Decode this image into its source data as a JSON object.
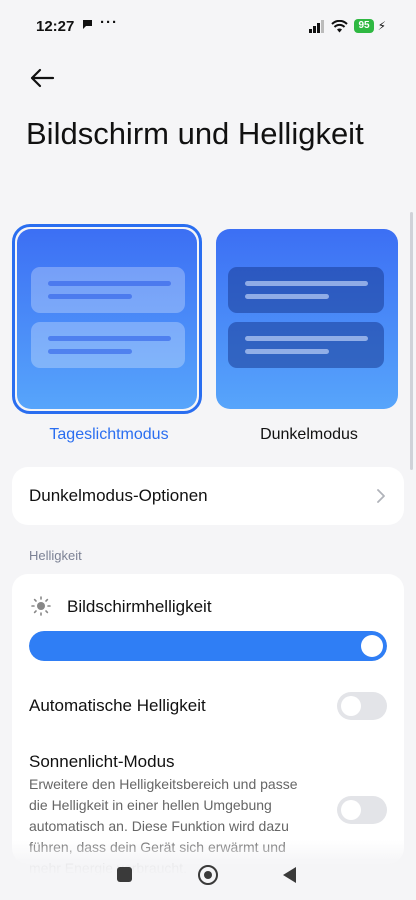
{
  "status_bar": {
    "time": "12:27",
    "notification_icon": "chat-bubble-icon",
    "more_indicator": "···",
    "battery_level": "95",
    "icons": [
      "signal-icon",
      "wifi-icon",
      "battery-icon",
      "charging-icon"
    ]
  },
  "header": {
    "back_icon": "arrow-left-icon",
    "title": "Bildschirm und Helligkeit"
  },
  "modes": {
    "light_label": "Tageslichtmodus",
    "dark_label": "Dunkelmodus",
    "selected": "light"
  },
  "dark_options": {
    "label": "Dunkelmodus-Optionen",
    "icon": "chevron-right-icon"
  },
  "section": {
    "title": "Helligkeit"
  },
  "brightness": {
    "icon": "sun-icon",
    "label": "Bildschirmhelligkeit",
    "level": 1.0
  },
  "auto_brightness": {
    "label": "Automatische Helligkeit",
    "enabled": false
  },
  "sunlight_mode": {
    "label": "Sonnenlicht-Modus",
    "description": "Erweitere den Helligkeitsbereich und passe die Helligkeit in einer hellen Umgebung automatisch an. Diese Funktion wird dazu führen, dass dein Gerät sich erwärmt und mehr Energie verbraucht.",
    "enabled": false
  },
  "nav_bar": {
    "icons": [
      "recents-icon",
      "home-icon",
      "back-icon"
    ]
  },
  "colors": {
    "accent": "#2a6ef0",
    "background": "#f5f5f7",
    "card": "#ffffff",
    "battery": "#2fb842"
  }
}
